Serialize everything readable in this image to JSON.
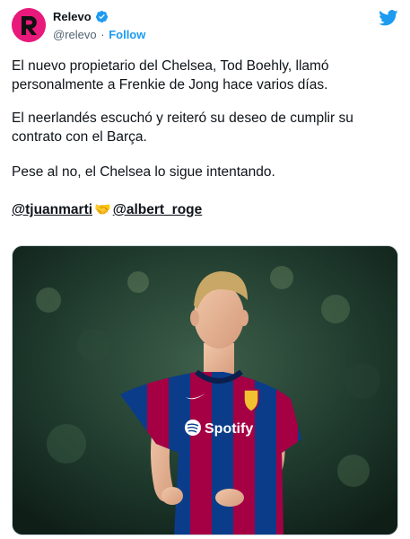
{
  "header": {
    "name": "Relevo",
    "handle": "@relevo",
    "separator": "·",
    "follow_label": "Follow"
  },
  "tweet": {
    "paragraph1": "El nuevo propietario del Chelsea, Tod Boehly, llamó personalmente a Frenkie de Jong hace varios días.",
    "paragraph2": "El neerlandés escuchó y reiteró su deseo de cumplir su contrato con el Barça.",
    "paragraph3": "Pese al no, el Chelsea lo sigue intentando.",
    "mention1": "@tjuanmarti",
    "mention2": "@albert_roge"
  },
  "photo": {
    "sponsor": "Spotify"
  },
  "colors": {
    "accent": "#1d9bf0",
    "avatar_bg": "#e8197a",
    "barca_blue": "#0a3c8a",
    "barca_red": "#a50044"
  },
  "icons": {
    "verified": "verified-badge-icon",
    "twitter": "twitter-bird-icon",
    "handshake": "handshake-emoji-icon"
  }
}
